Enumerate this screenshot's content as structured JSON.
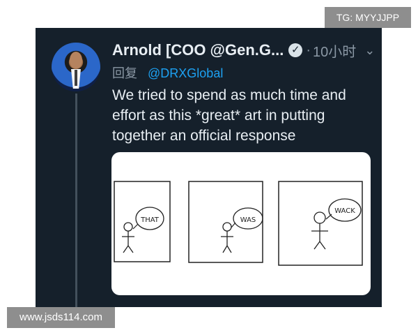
{
  "watermarks": {
    "top_right": "TG: MYYJJPP",
    "bottom_left": "www.jsds114.com"
  },
  "tweet": {
    "author_name": "Arnold [COO @Gen.G...",
    "verified": true,
    "separator": "·",
    "time": "10小时",
    "reply_prefix": "回复",
    "reply_handle": "@DRXGlobal",
    "text": "We tried to spend as much time and\neffort as this *great* art in putting\ntogether an official response"
  },
  "comic": {
    "panels": [
      {
        "speech": "THAT"
      },
      {
        "speech": "WAS"
      },
      {
        "speech": "WACK"
      }
    ]
  },
  "icons": {
    "verified": "verified-check-icon",
    "menu": "chevron-down-icon"
  },
  "colors": {
    "card_background": "#15202b",
    "primary_text": "#e8eef3",
    "secondary_text": "#8b98a5",
    "link": "#1da1f2",
    "watermark_background": "#8e8e8e"
  }
}
